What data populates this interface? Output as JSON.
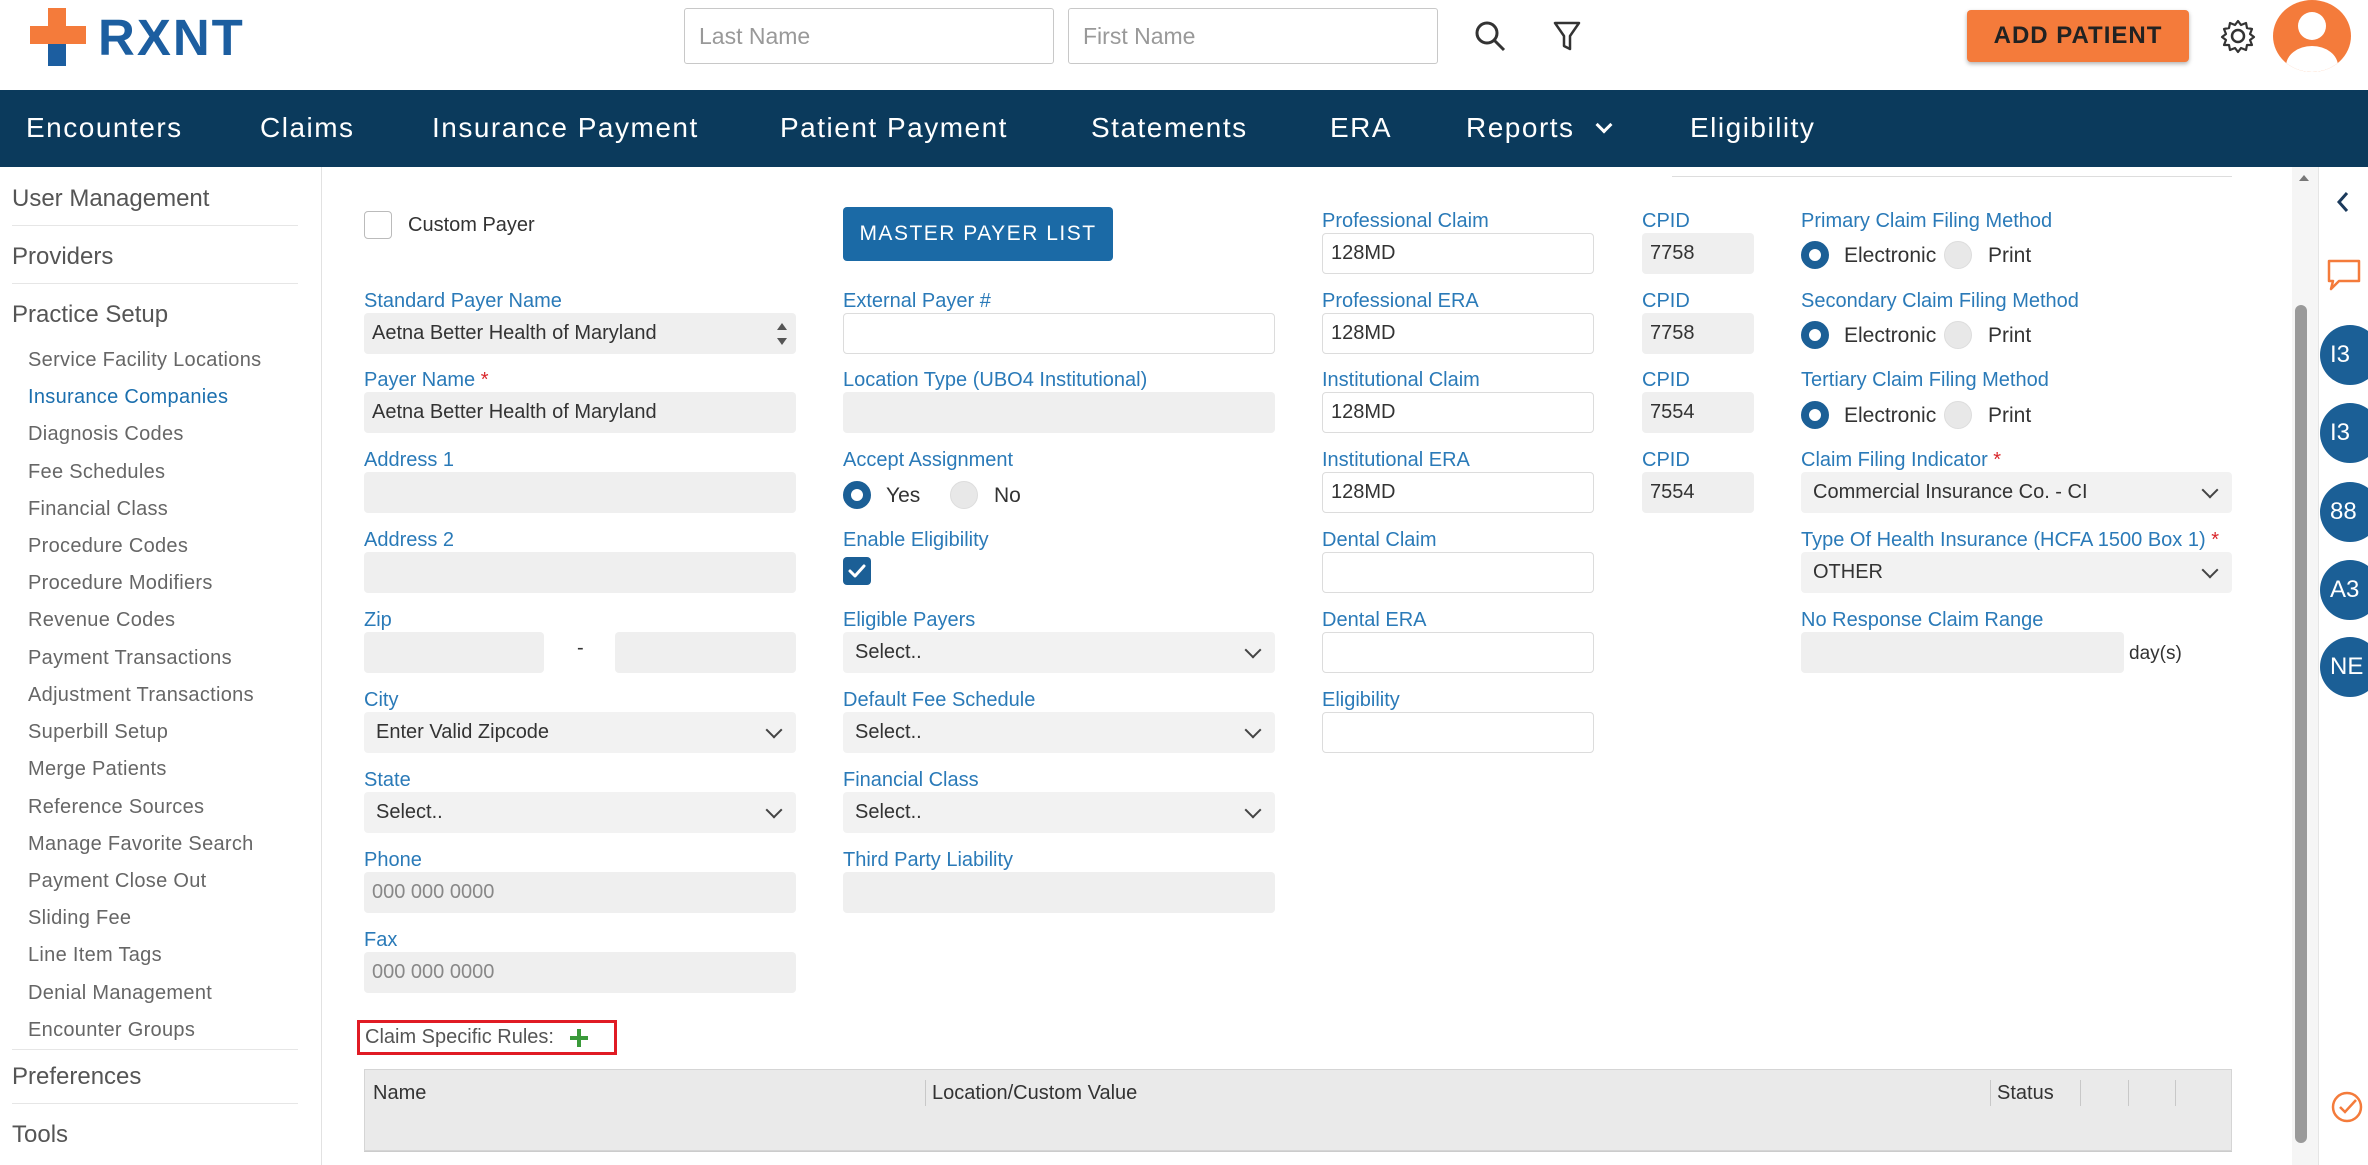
{
  "header": {
    "logo_text": "RXNT",
    "last_name_placeholder": "Last Name",
    "first_name_placeholder": "First Name",
    "add_patient_label": "ADD PATIENT"
  },
  "nav": {
    "items": [
      "Encounters",
      "Claims",
      "Insurance Payment",
      "Patient Payment",
      "Statements",
      "ERA",
      "Reports",
      "Eligibility"
    ]
  },
  "sidebar": {
    "user_management": "User Management",
    "providers": "Providers",
    "practice_setup": "Practice Setup",
    "items": [
      "Service Facility Locations",
      "Insurance Companies",
      "Diagnosis Codes",
      "Fee Schedules",
      "Financial Class",
      "Procedure Codes",
      "Procedure Modifiers",
      "Revenue Codes",
      "Payment Transactions",
      "Adjustment Transactions",
      "Superbill Setup",
      "Merge Patients",
      "Reference Sources",
      "Manage Favorite Search",
      "Payment Close Out",
      "Sliding Fee",
      "Line Item Tags",
      "Denial Management",
      "Encounter Groups"
    ],
    "active_item": "Insurance Companies",
    "preferences": "Preferences",
    "tools": "Tools"
  },
  "form": {
    "custom_payer_label": "Custom Payer",
    "master_payer_list_label": "MASTER PAYER LIST",
    "standard_payer_name_label": "Standard Payer Name",
    "standard_payer_name_value": "Aetna Better Health of Maryland",
    "payer_name_label": "Payer Name",
    "payer_name_value": "Aetna Better Health of Maryland",
    "address1_label": "Address 1",
    "address2_label": "Address 2",
    "zip_label": "Zip",
    "zip_dash": "-",
    "city_label": "City",
    "city_value": "Enter Valid Zipcode",
    "state_label": "State",
    "state_value": "Select..",
    "phone_label": "Phone",
    "phone_placeholder": "000 000 0000",
    "fax_label": "Fax",
    "fax_placeholder": "000 000 0000",
    "external_payer_label": "External Payer #",
    "location_type_label": "Location Type (UBO4 Institutional)",
    "accept_assignment_label": "Accept Assignment",
    "yes_label": "Yes",
    "no_label": "No",
    "accept_assignment_value": "Yes",
    "enable_eligibility_label": "Enable Eligibility",
    "enable_eligibility_checked": true,
    "eligible_payers_label": "Eligible Payers",
    "eligible_payers_value": "Select..",
    "default_fee_schedule_label": "Default Fee Schedule",
    "default_fee_schedule_value": "Select..",
    "financial_class_label": "Financial Class",
    "financial_class_value": "Select..",
    "third_party_liability_label": "Third Party Liability",
    "professional_claim_label": "Professional Claim",
    "professional_claim_value": "128MD",
    "professional_era_label": "Professional ERA",
    "professional_era_value": "128MD",
    "institutional_claim_label": "Institutional Claim",
    "institutional_claim_value": "128MD",
    "institutional_era_label": "Institutional ERA",
    "institutional_era_value": "128MD",
    "dental_claim_label": "Dental Claim",
    "dental_era_label": "Dental ERA",
    "eligibility_label": "Eligibility",
    "cpid_label": "CPID",
    "cpid_values": [
      "7758",
      "7758",
      "7554",
      "7554"
    ],
    "primary_filing_label": "Primary Claim Filing Method",
    "secondary_filing_label": "Secondary Claim Filing Method",
    "tertiary_filing_label": "Tertiary Claim Filing Method",
    "electronic_label": "Electronic",
    "print_label": "Print",
    "claim_filing_indicator_label": "Claim Filing Indicator",
    "claim_filing_indicator_value": "Commercial Insurance Co. - CI",
    "type_health_insurance_label": "Type Of Health Insurance (HCFA 1500 Box 1)",
    "type_health_insurance_value": "OTHER",
    "no_response_label": "No Response Claim Range",
    "days_label": "day(s)"
  },
  "rules": {
    "label": "Claim Specific Rules:",
    "columns": [
      "Name",
      "Location/Custom Value",
      "Status"
    ]
  },
  "right_panel": {
    "bubbles": [
      "I3",
      "I3",
      "88",
      "A3",
      "NE"
    ]
  },
  "colors": {
    "primary": "#1b5f96",
    "nav_bg": "#0b3a5c",
    "accent_orange": "#f47b3b",
    "label_blue": "#2a7ab8",
    "required_red": "#d9262b",
    "highlight_red": "#e01b24"
  }
}
